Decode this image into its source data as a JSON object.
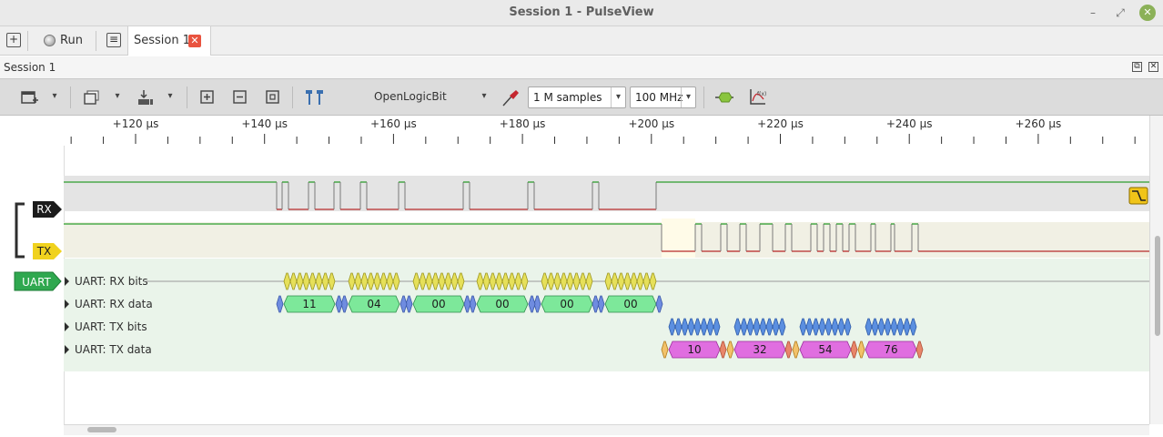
{
  "window": {
    "title": "Session 1 - PulseView",
    "controls": {
      "minimize": "–",
      "restore": "⤢",
      "close": "✕"
    }
  },
  "tabbar": {
    "new_session_glyph": "+",
    "run_label": "Run",
    "settings_glyph": "≡",
    "tab_label": "Session 1",
    "tab_close_glyph": "✕"
  },
  "session_header": {
    "label": "Session 1",
    "float_glyph": "⧉",
    "close_glyph": "✕"
  },
  "toolbar": {
    "device": "OpenLogicBit",
    "samples": "1 M samples",
    "samplerate": "100 MHz",
    "dropdown_glyph": "▾",
    "icons": [
      "add-view-icon",
      "save-icon",
      "import-icon",
      "zoom-in-icon",
      "zoom-out-icon",
      "zoom-fit-icon",
      "cursor-icon",
      "probe-icon",
      "decoder-icon",
      "math-icon"
    ],
    "accent_colors": {
      "cursor": "#3a6fb0",
      "probe": "#c4262e",
      "decoder": "#8ac53e"
    }
  },
  "ruler": {
    "labels": [
      "+120 µs",
      "+140 µs",
      "+160 µs",
      "+180 µs",
      "+200 µs",
      "+220 µs",
      "+240 µs",
      "+260 µs"
    ]
  },
  "channels": [
    {
      "name": "RX",
      "color": "#1b1b1b",
      "text_color": "#ffffff",
      "trigger_glyph": "⬎"
    },
    {
      "name": "TX",
      "color": "#f0d21e",
      "text_color": "#222222"
    }
  ],
  "decoder": {
    "name": "UART",
    "color": "#2fa84f",
    "rows": [
      {
        "label": "UART: RX bits"
      },
      {
        "label": "UART: RX data",
        "values": [
          "11",
          "04",
          "00",
          "00",
          "00",
          "00"
        ]
      },
      {
        "label": "UART: TX bits"
      },
      {
        "label": "UART: TX data",
        "values": [
          "10",
          "32",
          "54",
          "76"
        ]
      }
    ]
  },
  "colors": {
    "rx_bits": "#e6e05a",
    "rx_data": "#7de89a",
    "tx_bits": "#5b8fe0",
    "tx_data": "#e06ee0",
    "start_bit": "#6f8ce0",
    "stop_bit": "#e8866a",
    "tx_start_bit": "#f2c26a",
    "signal_high": "#2e9e2e",
    "signal_low": "#b72a2a"
  }
}
